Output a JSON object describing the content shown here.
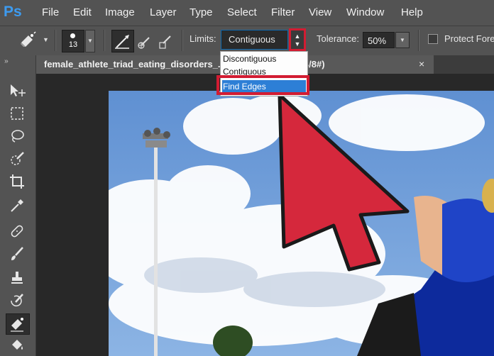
{
  "app": {
    "logo": "Ps"
  },
  "menubar": {
    "items": [
      {
        "label": "File"
      },
      {
        "label": "Edit"
      },
      {
        "label": "Image"
      },
      {
        "label": "Layer"
      },
      {
        "label": "Type"
      },
      {
        "label": "Select"
      },
      {
        "label": "Filter"
      },
      {
        "label": "View"
      },
      {
        "label": "Window"
      },
      {
        "label": "Help"
      }
    ]
  },
  "options_bar": {
    "tool_icon": "background-eraser-icon",
    "brush_size": "13",
    "limits_label": "Limits:",
    "limits_value": "Contiguous",
    "tolerance_label": "Tolerance:",
    "tolerance_value": "50%",
    "protect_label": "Protect Foreg"
  },
  "document": {
    "tab_title": "female_athlete_triad_eating_disorders_...ts.jpg @ 55% (RGB/8#)",
    "close_glyph": "×"
  },
  "panel": {
    "collapse_glyph": "››"
  },
  "limits_dropdown": {
    "options": [
      "Discontiguous",
      "Contiguous",
      "Find Edges"
    ],
    "highlighted": "Find Edges"
  },
  "annotation": {
    "color": "#d5283c",
    "outline": "#1a1a1a"
  },
  "toolbar": {
    "tools": [
      "move-icon",
      "marquee-icon",
      "lasso-icon",
      "quick-selection-icon",
      "crop-icon",
      "eyedropper-icon",
      "healing-brush-icon",
      "brush-icon",
      "clone-stamp-icon",
      "history-brush-icon",
      "eraser-icon",
      "paint-bucket-icon"
    ]
  },
  "colors": {
    "menu_bg": "#535353",
    "canvas_bg": "#282828",
    "selection": "#2d7fd6",
    "highlight_red": "#d21c32"
  }
}
